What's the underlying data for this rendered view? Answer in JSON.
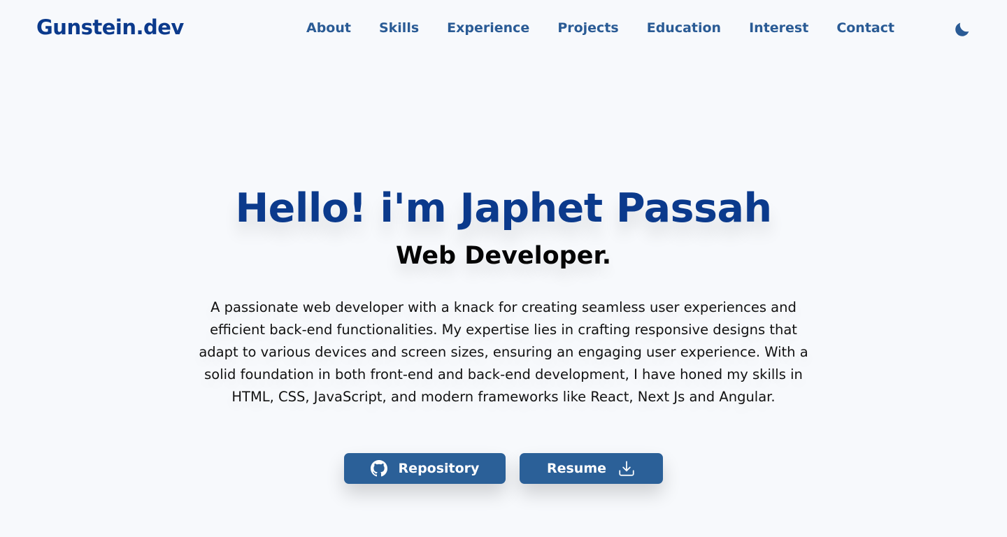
{
  "header": {
    "logo": "Gunstein.dev",
    "nav": [
      {
        "label": "About"
      },
      {
        "label": "Skills"
      },
      {
        "label": "Experience"
      },
      {
        "label": "Projects"
      },
      {
        "label": "Education"
      },
      {
        "label": "Interest"
      },
      {
        "label": "Contact"
      }
    ],
    "theme_toggle_icon": "moon-icon"
  },
  "hero": {
    "title": "Hello! i'm Japhet Passah",
    "subtitle": "Web Developer.",
    "description": "A passionate web developer with a knack for creating seamless user experiences and efficient back-end functionalities. My expertise lies in crafting responsive designs that adapt to various devices and screen sizes, ensuring an engaging user experience. With a solid foundation in both front-end and back-end development, I have honed my skills in HTML, CSS, JavaScript, and modern frameworks like React, Next Js and Angular."
  },
  "buttons": {
    "repository": {
      "label": "Repository",
      "icon": "github-icon"
    },
    "resume": {
      "label": "Resume",
      "icon": "download-icon"
    }
  },
  "colors": {
    "brand": "#0b3a8c",
    "nav": "#2a5b95",
    "button": "#2b6098",
    "background": "#f7f9fc"
  }
}
